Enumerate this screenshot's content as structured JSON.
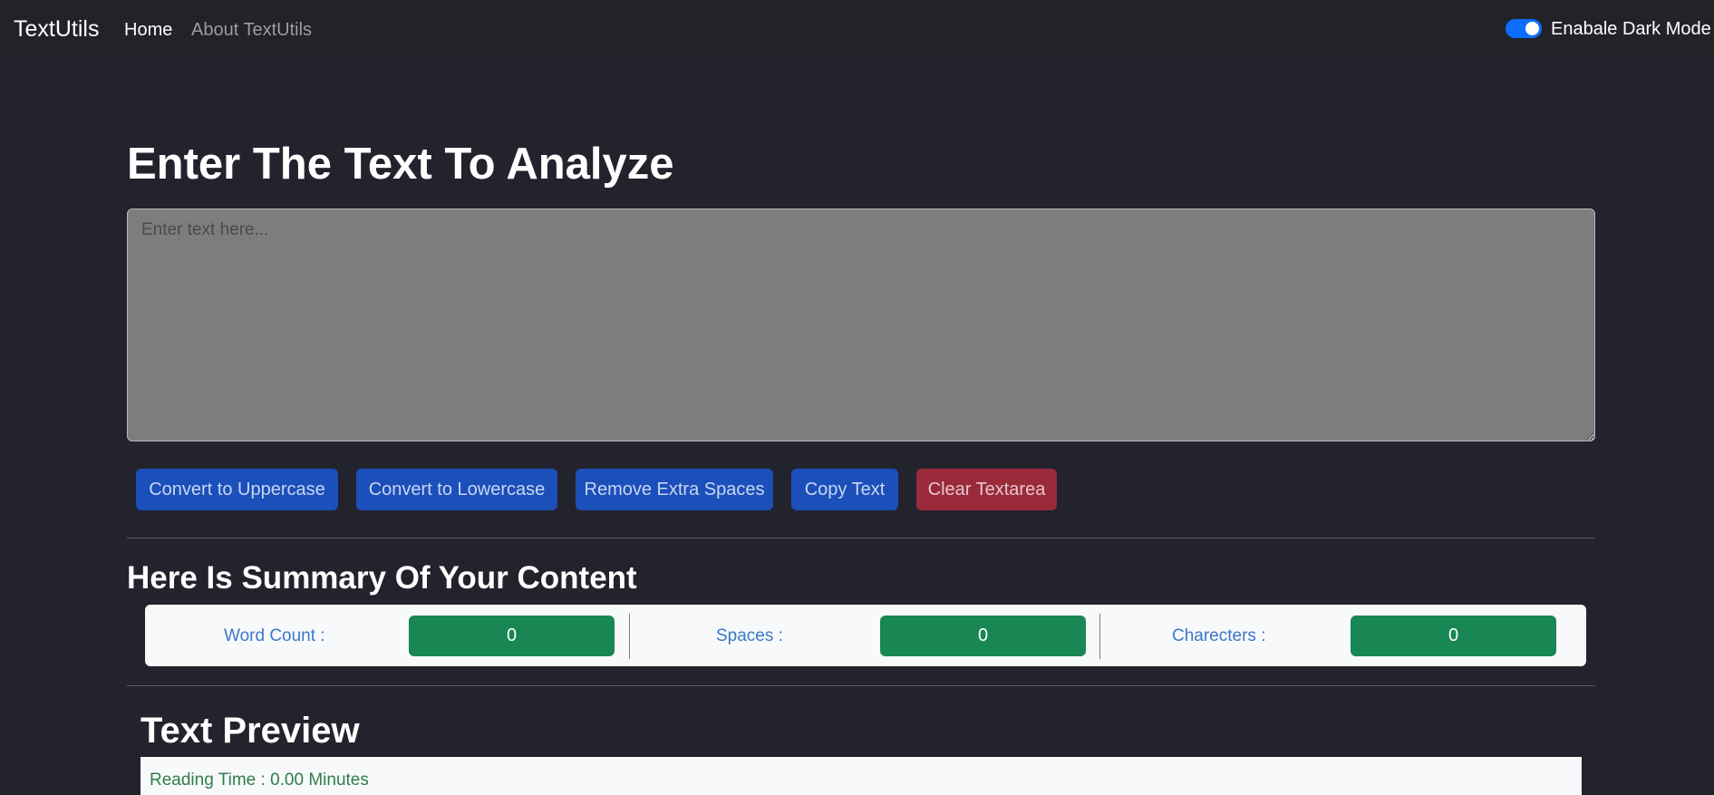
{
  "navbar": {
    "brand": "TextUtils",
    "links": [
      "Home",
      "About TextUtils"
    ],
    "dark_mode_label": "Enabale Dark Mode",
    "dark_mode_enabled": true
  },
  "main": {
    "heading": "Enter The Text To Analyze",
    "textarea": {
      "value": "",
      "placeholder": "Enter text here..."
    },
    "buttons": {
      "uppercase": "Convert to Uppercase",
      "lowercase": "Convert to Lowercase",
      "remove_spaces": "Remove Extra Spaces",
      "copy": "Copy Text",
      "clear": "Clear Textarea"
    }
  },
  "summary": {
    "heading": "Here Is Summary Of Your Content",
    "stats": [
      {
        "label": "Word Count :",
        "value": "0"
      },
      {
        "label": "Spaces :",
        "value": "0"
      },
      {
        "label": "Charecters :",
        "value": "0"
      }
    ]
  },
  "preview": {
    "heading": "Text Preview",
    "reading_time": "Reading Time : 0.00 Minutes"
  },
  "colors": {
    "background": "#22232d",
    "primary_button": "#1b4fba",
    "danger_button": "#9a2a3a",
    "stat_badge": "#198754",
    "toggle_accent": "#0d6efd"
  }
}
